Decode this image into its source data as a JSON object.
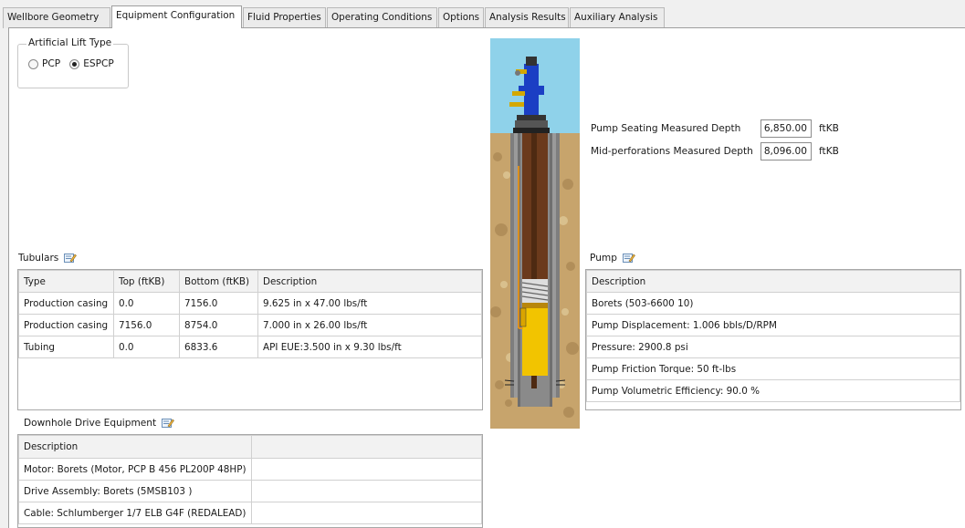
{
  "tabs": [
    "Wellbore Geometry",
    "Equipment Configuration",
    "Fluid Properties",
    "Operating Conditions",
    "Options",
    "Analysis Results",
    "Auxiliary Analysis"
  ],
  "lift": {
    "title": "Artificial Lift Type",
    "option1": "PCP",
    "option2": "ESPCP",
    "selected": "ESPCP"
  },
  "depths": {
    "pump_label": "Pump Seating Measured Depth",
    "pump_value": "6,850.00",
    "pump_unit": "ftKB",
    "perf_label": "Mid-perforations Measured Depth",
    "perf_value": "8,096.00",
    "perf_unit": "ftKB"
  },
  "tubulars": {
    "title": "Tubulars",
    "headers": [
      "Type",
      "Top (ftKB)",
      "Bottom (ftKB)",
      "Description"
    ],
    "rows": [
      [
        "Production casing",
        "0.0",
        "7156.0",
        "9.625 in x 47.00 lbs/ft"
      ],
      [
        "Production casing",
        "7156.0",
        "8754.0",
        "7.000 in x 26.00 lbs/ft"
      ],
      [
        "Tubing",
        "0.0",
        "6833.6",
        "API EUE:3.500 in x 9.30 lbs/ft"
      ]
    ]
  },
  "pump": {
    "title": "Pump",
    "header": "Description",
    "rows": [
      "Borets (503-6600 10)",
      "Pump Displacement: 1.006 bbls/D/RPM",
      "Pressure: 2900.8 psi",
      "Pump Friction Torque: 50 ft-lbs",
      "Pump Volumetric Efficiency: 90.0 %"
    ]
  },
  "drive": {
    "title": "Downhole Drive Equipment",
    "header": "Description",
    "rows": [
      "Motor: Borets (Motor, PCP B 456 PL200P 48HP)",
      "Drive Assembly: Borets (5MSB103 )",
      "Cable: Schlumberger 1/7 ELB G4F (REDALEAD)"
    ]
  },
  "colors": {
    "sky": "#87ceeb",
    "earth": "#c9a56a",
    "casing": "#7b7b7b",
    "tubing": "#6b3b1f",
    "pump": "#f2c500",
    "wellhead": "#1e3fbf"
  }
}
